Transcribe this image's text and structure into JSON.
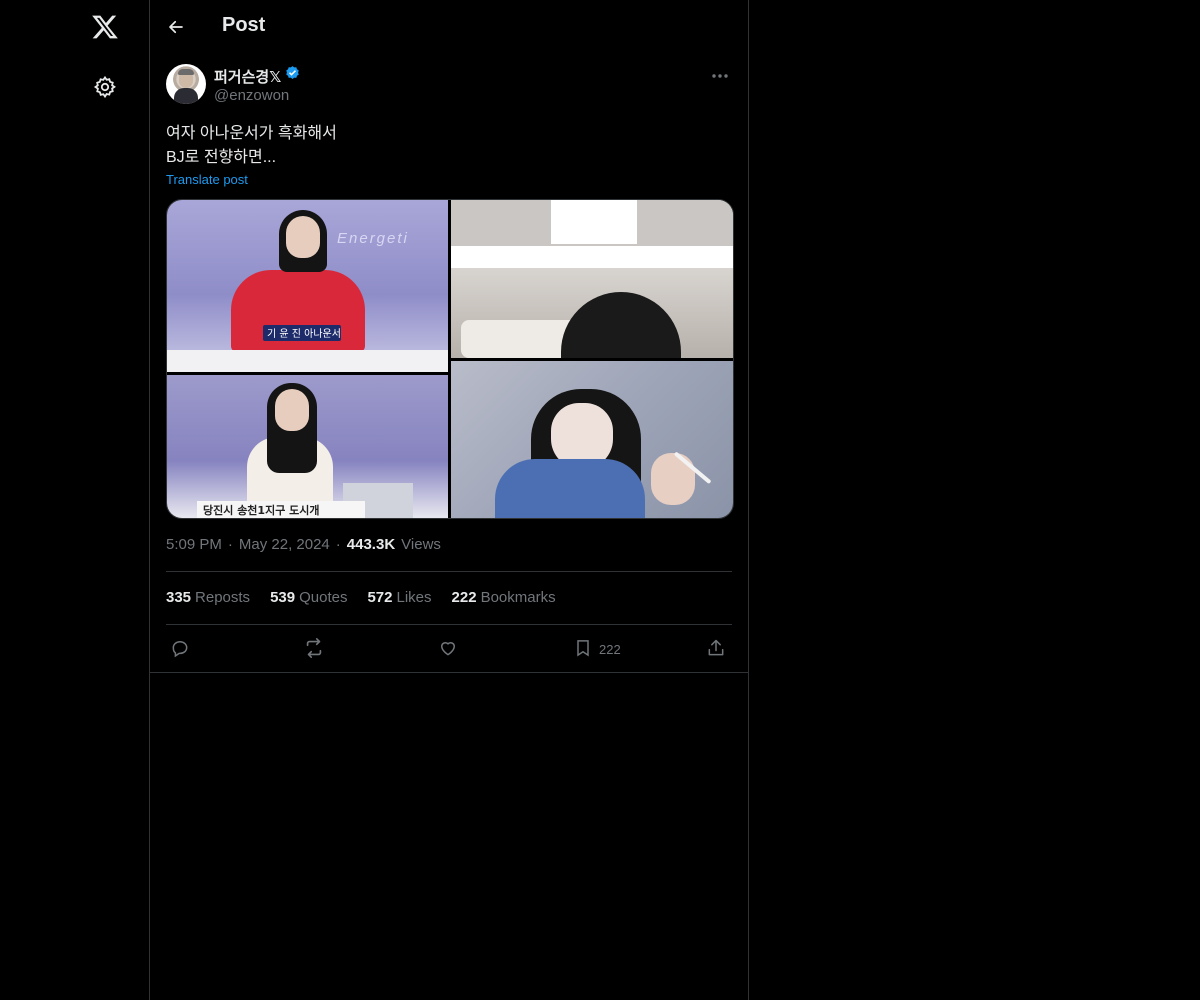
{
  "nav": {
    "logo_icon": "x-logo-icon",
    "settings_icon": "gear-icon"
  },
  "topbar": {
    "title": "Post"
  },
  "post": {
    "display_name": "퍼거슨경𝕏",
    "handle": "@enzowon",
    "text": "여자 아나운서가 흑화해서\nBJ로 전향하면...",
    "translate_label": "Translate post",
    "media": {
      "nameplate": "기 윤 진  아나운서",
      "overlay_brand": "Energeti",
      "ticker": "당진시 송천1지구 도시개"
    },
    "time": "5:09 PM",
    "date": "May 22, 2024",
    "views_count": "443.3K",
    "views_label": "Views",
    "stats": {
      "reposts_count": "335",
      "reposts_label": "Reposts",
      "quotes_count": "539",
      "quotes_label": "Quotes",
      "likes_count": "572",
      "likes_label": "Likes",
      "bookmarks_count": "222",
      "bookmarks_label": "Bookmarks"
    },
    "actions": {
      "bookmark_count": "222"
    }
  },
  "colors": {
    "background": "#000000",
    "text": "#e7e9ea",
    "muted": "#71767b",
    "link": "#1d9bf0",
    "border": "#2f3336",
    "verified": "#1d9bf0"
  }
}
